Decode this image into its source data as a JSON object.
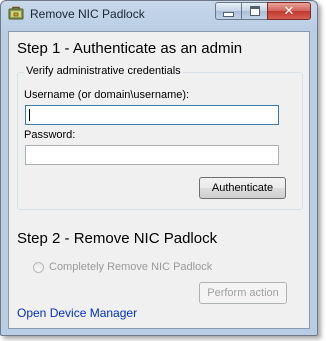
{
  "window": {
    "title": "Remove NIC Padlock"
  },
  "step1": {
    "heading": "Step 1 - Authenticate as an admin",
    "group_title": "Verify administrative credentials",
    "username_label": "Username (or domain\\username):",
    "username_value": "",
    "password_label": "Password:",
    "password_value": "",
    "authenticate_button": "Authenticate"
  },
  "step2": {
    "heading": "Step 2 - Remove NIC Padlock",
    "radio_label": "Completely Remove NIC Padlock",
    "radio_enabled": false,
    "perform_button": "Perform action",
    "perform_enabled": false
  },
  "footer": {
    "link": "Open Device Manager"
  },
  "colors": {
    "link": "#0033bb",
    "close_button": "#c0392f",
    "titlebar": "#b9cde3"
  },
  "icons": {
    "app": "padlock-icon",
    "minimize": "minimize-icon",
    "maximize": "maximize-icon",
    "close": "close-icon"
  }
}
